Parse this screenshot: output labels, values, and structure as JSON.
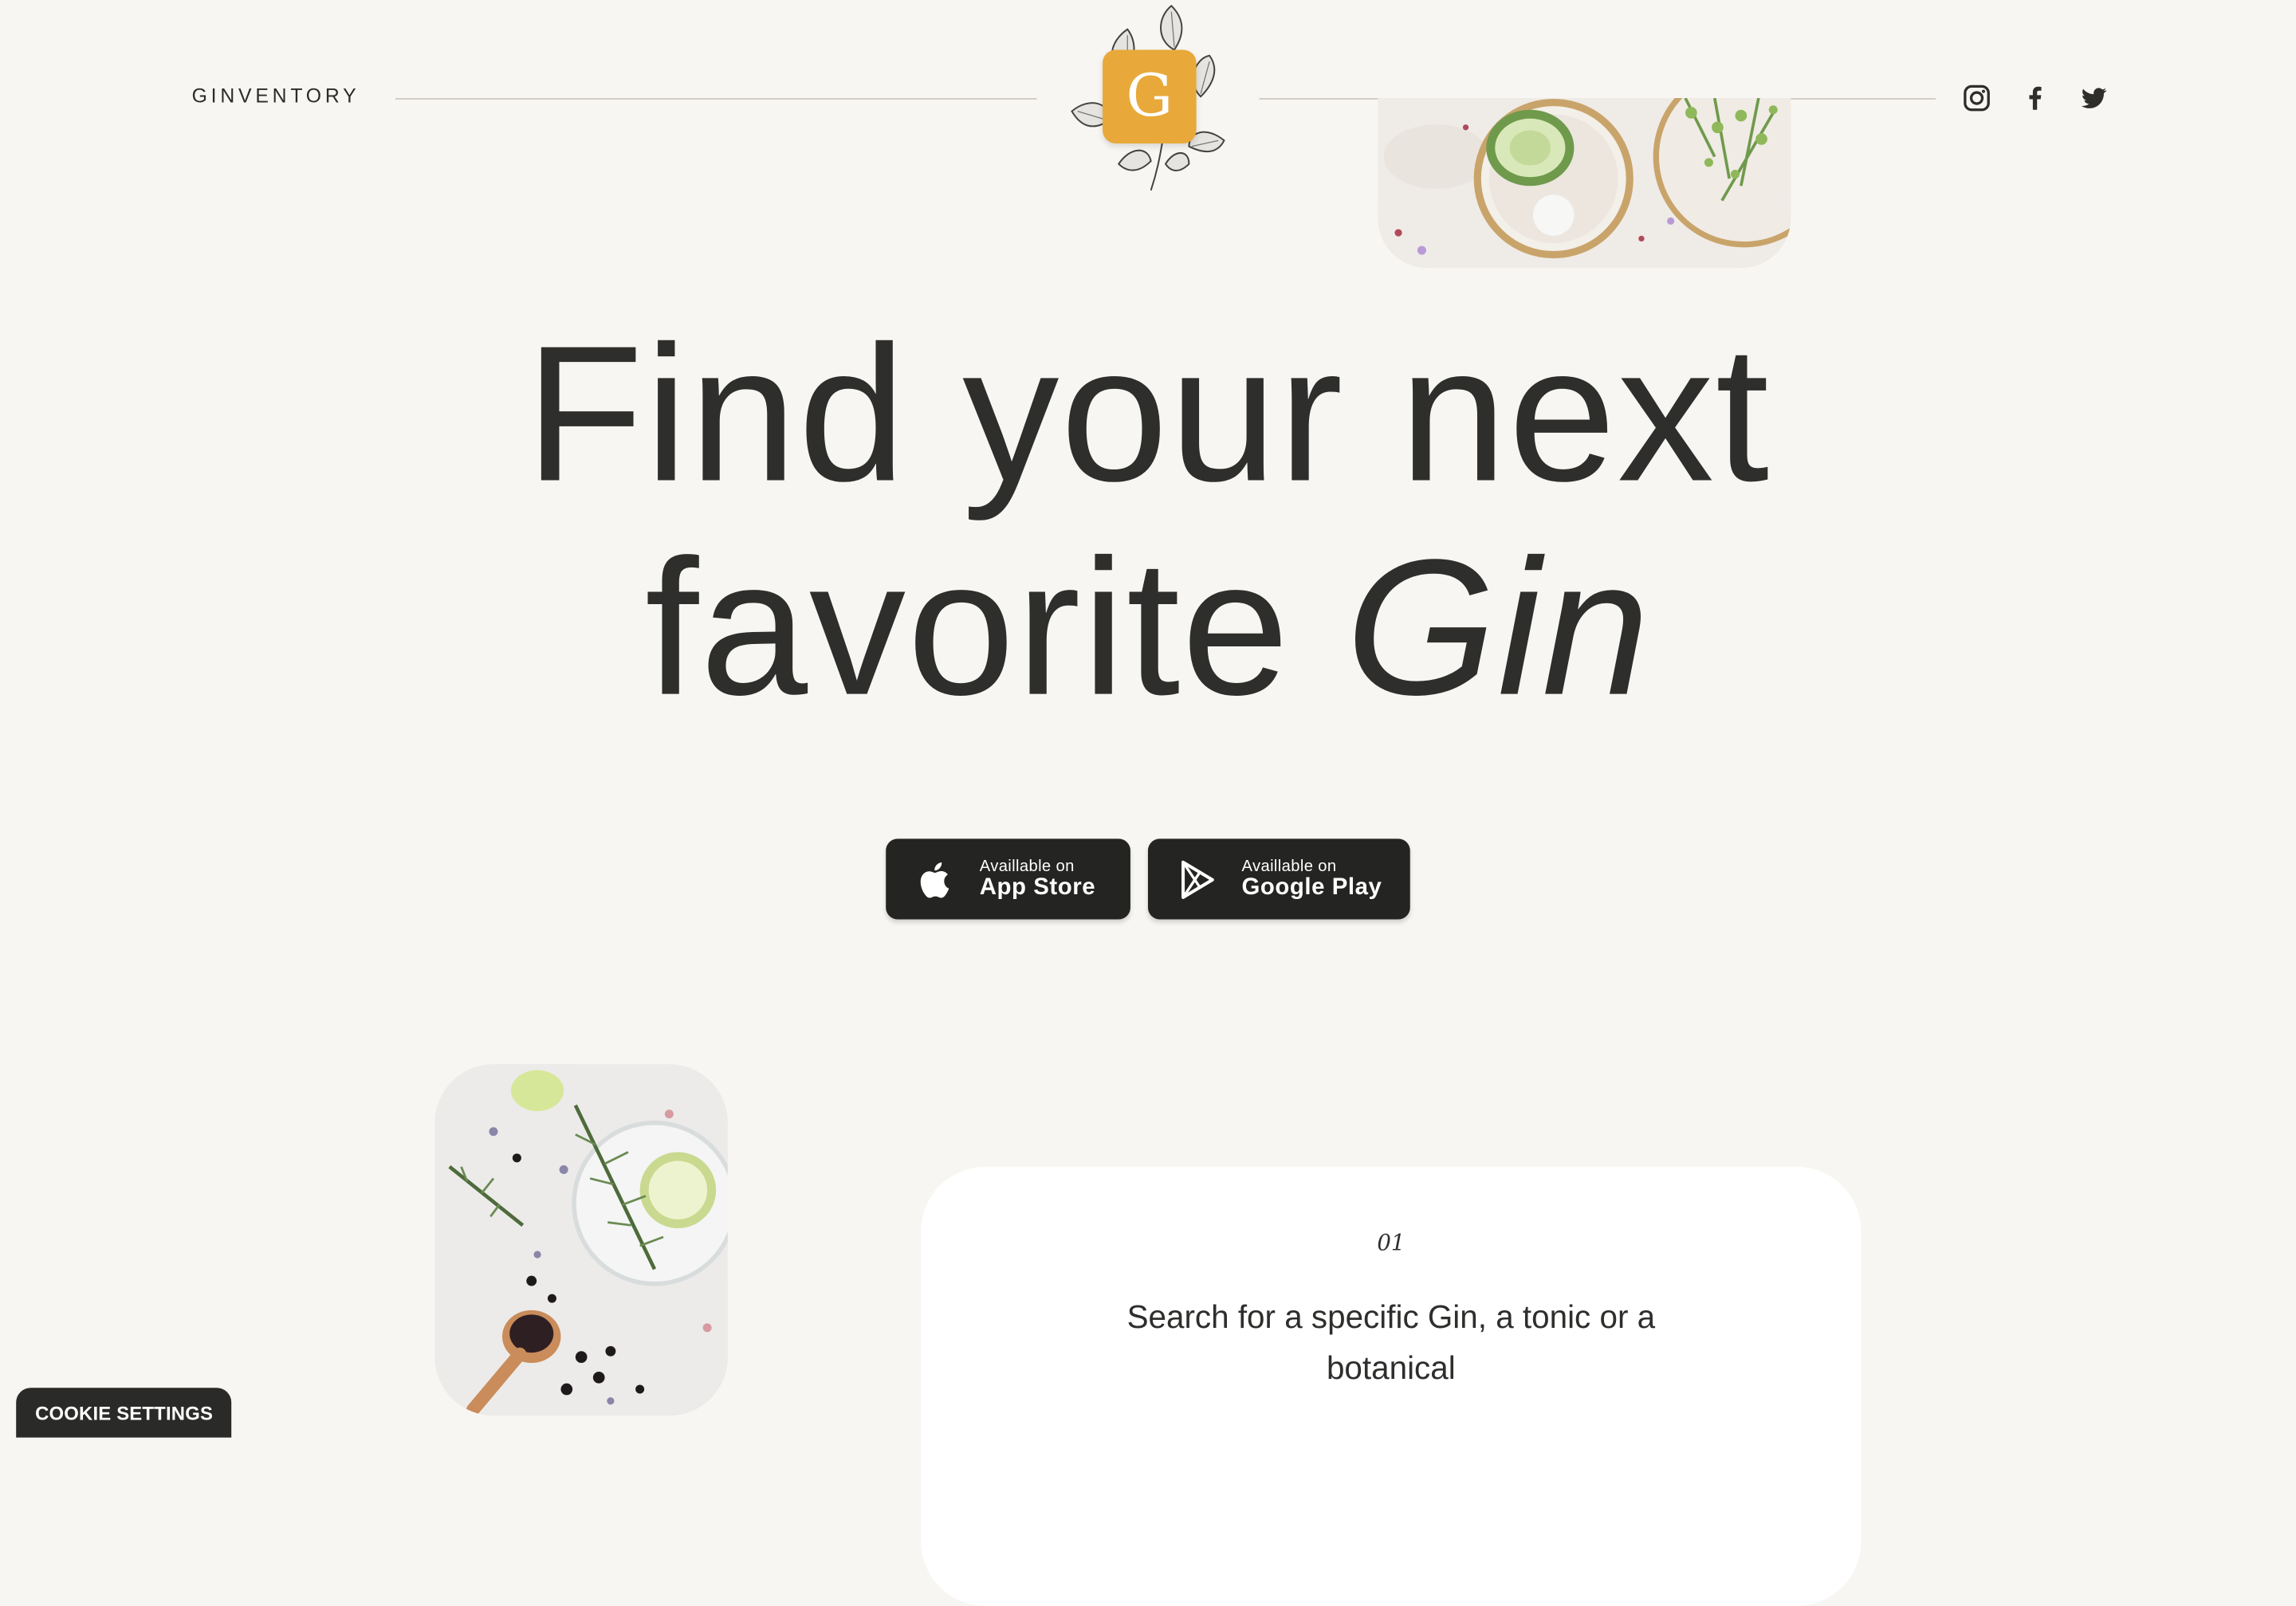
{
  "header": {
    "brand": "GINVENTORY",
    "logo_letter": "G"
  },
  "social": {
    "icons": [
      "instagram-icon",
      "facebook-icon",
      "twitter-icon"
    ]
  },
  "hero": {
    "line1": "Find your next",
    "line2_plain": "favorite",
    "line2_italic": "Gin"
  },
  "stores": {
    "apple_small": "Availlable on",
    "apple_big": "App Store",
    "google_small": "Availlable on",
    "google_big": "Google Play"
  },
  "feature": {
    "number": "01",
    "text": "Search for a specific Gin, a tonic or a botanical"
  },
  "cookie": {
    "label": "COOKIE SETTINGS"
  },
  "colors": {
    "background": "#f8f6f2",
    "text": "#2e2e2c",
    "logo_badge": "#e8a93a",
    "button": "#242422"
  }
}
